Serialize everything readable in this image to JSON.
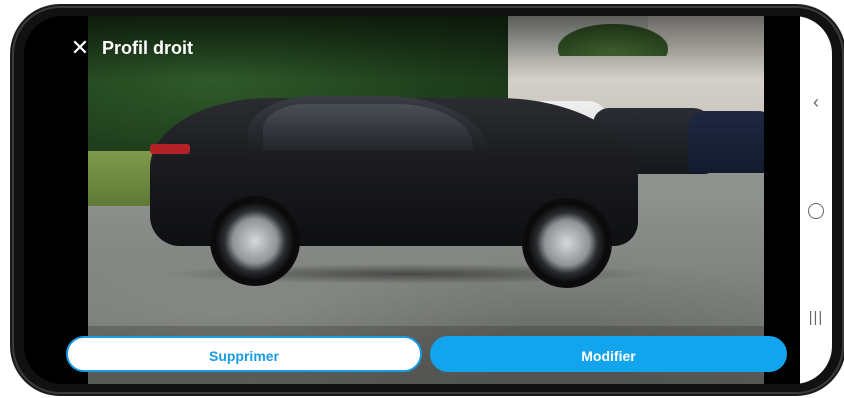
{
  "header": {
    "close_icon": "close-icon",
    "title": "Profil droit"
  },
  "actions": {
    "delete_label": "Supprimer",
    "edit_label": "Modifier"
  },
  "colors": {
    "accent": "#12a4ec",
    "accent_outline": "#1a9be6",
    "title_text": "#ffffff"
  },
  "system_nav": {
    "back_icon": "chevron-left-icon",
    "home_icon": "circle-home-icon",
    "recents_icon": "recent-apps-icon"
  }
}
